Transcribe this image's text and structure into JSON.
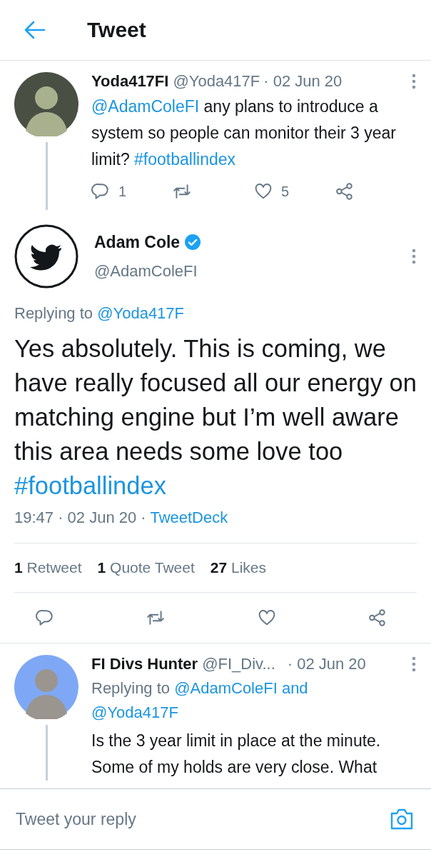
{
  "header": {
    "title": "Tweet"
  },
  "parent_tweet": {
    "name": "Yoda417FI",
    "handle": "@Yoda417F",
    "time": "· 02 Jun 20",
    "body": [
      {
        "kind": "mention",
        "text": "@AdamColeFI"
      },
      {
        "kind": "plain",
        "text": " any plans to introduce a system so people can monitor their 3 year limit? "
      },
      {
        "kind": "hashtag",
        "text": "#footballindex"
      }
    ],
    "actions": [
      {
        "kind": "reply",
        "count": "1"
      },
      {
        "kind": "retweet"
      },
      {
        "kind": "like",
        "count": "5"
      },
      {
        "kind": "share"
      }
    ]
  },
  "main_tweet": {
    "name": "Adam Cole",
    "verified": true,
    "handle": "@AdamColeFI",
    "replying": [
      {
        "kind": "plain",
        "text": "Replying to "
      },
      {
        "kind": "mention",
        "text": "@Yoda417F"
      }
    ],
    "body": [
      {
        "kind": "plain",
        "text": "Yes absolutely. This is coming, we have really focused all our energy on matching engine but I’m well aware this area needs some love too "
      },
      {
        "kind": "hashtag",
        "text": "#footballindex"
      }
    ],
    "meta": [
      {
        "kind": "plain",
        "text": "19:47 · 02 Jun 20 · "
      },
      {
        "kind": "source",
        "text": "TweetDeck"
      }
    ],
    "stats": [
      {
        "count": "1",
        "label": "Retweet"
      },
      {
        "count": "1",
        "label": "Quote Tweet"
      },
      {
        "count": "27",
        "label": "Likes"
      }
    ],
    "actions": [
      {
        "kind": "reply"
      },
      {
        "kind": "retweet"
      },
      {
        "kind": "like"
      },
      {
        "kind": "share"
      }
    ]
  },
  "reply_tweet": {
    "name": "FI Divs Hunter",
    "handle": "@FI_Div...",
    "time": "· 02 Jun 20",
    "replying": [
      {
        "kind": "plain",
        "text": "Replying to "
      },
      {
        "kind": "mention",
        "text": "@AdamColeFI and"
      },
      {
        "kind": "break"
      },
      {
        "kind": "mention",
        "text": "@Yoda417F"
      }
    ],
    "body": [
      {
        "kind": "plain",
        "text": "Is the 3 year limit in place at the minute. Some of my holds are very close. What"
      }
    ]
  },
  "reply_bar": {
    "placeholder": "Tweet your reply"
  }
}
